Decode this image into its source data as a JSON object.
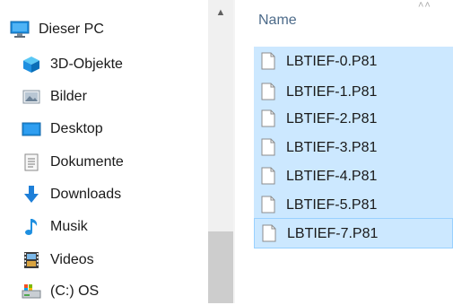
{
  "nav": {
    "items": [
      {
        "label": "Dieser PC",
        "icon": "this-pc-icon"
      },
      {
        "label": "3D-Objekte",
        "icon": "3d-objects-icon"
      },
      {
        "label": "Bilder",
        "icon": "pictures-icon"
      },
      {
        "label": "Desktop",
        "icon": "desktop-icon"
      },
      {
        "label": "Dokumente",
        "icon": "documents-icon"
      },
      {
        "label": "Downloads",
        "icon": "downloads-icon"
      },
      {
        "label": "Musik",
        "icon": "music-icon"
      },
      {
        "label": "Videos",
        "icon": "videos-icon"
      },
      {
        "label": "(C:) OS",
        "icon": "drive-icon"
      }
    ]
  },
  "list": {
    "header": "Name",
    "files": [
      {
        "name": "LBTIEF-0.P81"
      },
      {
        "name": "LBTIEF-1.P81"
      },
      {
        "name": "LBTIEF-2.P81"
      },
      {
        "name": "LBTIEF-3.P81"
      },
      {
        "name": "LBTIEF-4.P81"
      },
      {
        "name": "LBTIEF-5.P81"
      },
      {
        "name": "LBTIEF-7.P81"
      }
    ]
  },
  "colors": {
    "selection": "#cce8ff",
    "selection_border": "#99d1ff",
    "header_text": "#4d6b8a",
    "scrollbar_track": "#f0f0f0",
    "scrollbar_thumb": "#cdcdcd"
  }
}
